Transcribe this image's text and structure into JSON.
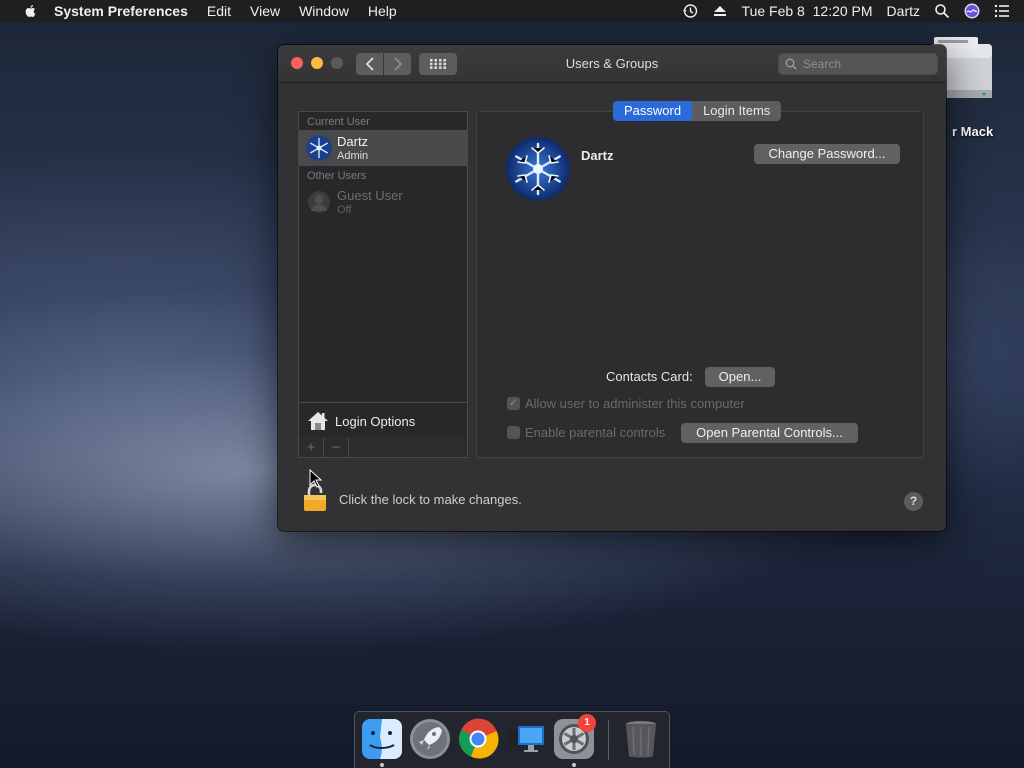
{
  "menubar": {
    "app_name": "System Preferences",
    "menus": [
      "Edit",
      "View",
      "Window",
      "Help"
    ],
    "datetime": "Tue Feb 8  12:20 PM",
    "user": "Dartz"
  },
  "desktop": {
    "disk_label": "r Mack"
  },
  "window": {
    "title": "Users & Groups",
    "search_placeholder": "Search"
  },
  "sidebar": {
    "current_user_header": "Current User",
    "current_user": {
      "name": "Dartz",
      "role": "Admin"
    },
    "other_users_header": "Other Users",
    "other_users": [
      {
        "name": "Guest User",
        "role": "Off"
      }
    ],
    "login_options": "Login Options",
    "add_label": "+",
    "remove_label": "−"
  },
  "main": {
    "tabs": [
      "Password",
      "Login Items"
    ],
    "active_tab": "Password",
    "user_name": "Dartz",
    "change_password": "Change Password...",
    "contacts_card_label": "Contacts Card:",
    "open_button": "Open...",
    "allow_admin": {
      "label": "Allow user to administer this computer",
      "checked": true
    },
    "parental": {
      "label": "Enable parental controls",
      "checked": false
    },
    "open_parental": "Open Parental Controls..."
  },
  "footer": {
    "lock_text": "Click the lock to make changes.",
    "help": "?"
  },
  "dock": {
    "apps": [
      "finder-icon",
      "launchpad-icon",
      "chrome-icon",
      "screen-sharing-icon",
      "system-preferences-icon",
      "trash-icon"
    ],
    "system_preferences_badge": "1"
  },
  "colors": {
    "accent": "#2a6ad9",
    "window_bg": "#323234",
    "badge": "#f4423c"
  }
}
